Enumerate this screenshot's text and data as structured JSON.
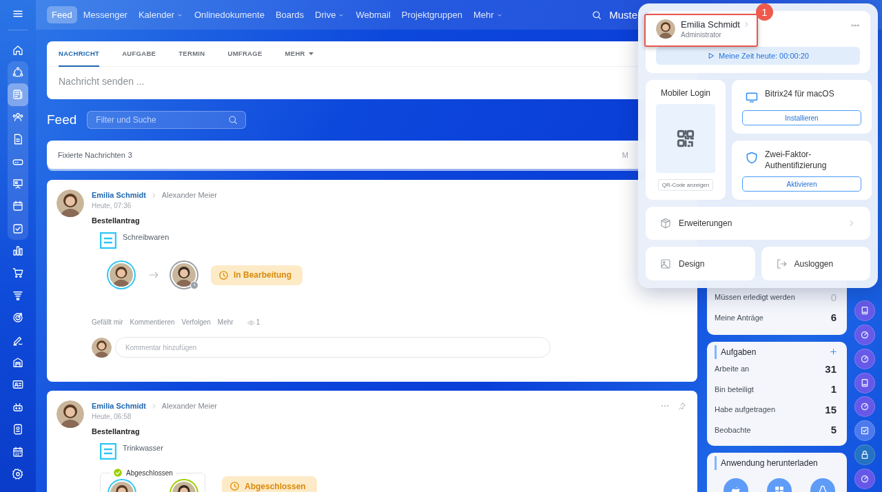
{
  "sidebar": {
    "items": [
      {
        "selected": false
      },
      {
        "selected": false
      },
      {
        "selected": false
      },
      {
        "selected": true
      },
      {
        "selected": false
      },
      {
        "selected": false
      },
      {
        "selected": false
      },
      {
        "selected": false
      },
      {
        "selected": false
      },
      {
        "selected": false
      },
      {
        "selected": false
      },
      {
        "selected": false
      },
      {
        "selected": false
      },
      {
        "selected": false
      },
      {
        "selected": false
      },
      {
        "selected": false
      },
      {
        "selected": false
      },
      {
        "selected": false
      },
      {
        "selected": false
      },
      {
        "selected": false
      },
      {
        "selected": false
      }
    ]
  },
  "topbar": {
    "nav": [
      {
        "label": "Feed",
        "selected": true,
        "dropdown": false
      },
      {
        "label": "Messenger",
        "selected": false,
        "dropdown": false
      },
      {
        "label": "Kalender",
        "selected": false,
        "dropdown": true
      },
      {
        "label": "Onlinedokumente",
        "selected": false,
        "dropdown": false
      },
      {
        "label": "Boards",
        "selected": false,
        "dropdown": false
      },
      {
        "label": "Drive",
        "selected": false,
        "dropdown": true
      },
      {
        "label": "Webmail",
        "selected": false,
        "dropdown": false
      },
      {
        "label": "Projektgruppen",
        "selected": false,
        "dropdown": false
      },
      {
        "label": "Mehr",
        "selected": false,
        "dropdown": true
      }
    ],
    "user_name": "Muste"
  },
  "composer": {
    "tabs": [
      {
        "label": "NACHRICHT",
        "selected": true,
        "dropdown": false
      },
      {
        "label": "AUFGABE",
        "selected": false,
        "dropdown": false
      },
      {
        "label": "TERMIN",
        "selected": false,
        "dropdown": false
      },
      {
        "label": "UMFRAGE",
        "selected": false,
        "dropdown": false
      },
      {
        "label": "MEHR",
        "selected": false,
        "dropdown": true
      }
    ],
    "placeholder": "Nachricht senden ..."
  },
  "feed": {
    "title": "Feed",
    "filter_placeholder": "Filter und Suche",
    "pinned": {
      "label": "Fixierte Nachrichten",
      "count": "3",
      "more": "M"
    },
    "posts": [
      {
        "author": "Emilia Schmidt",
        "recipient": "Alexander Meier",
        "time": "Heute, 07:36",
        "title": "Bestellantrag",
        "document": "Schreibwaren",
        "flow": {
          "kind": "in_progress",
          "status": "In Bearbeitung"
        },
        "actions": [
          "Gefällt mir",
          "Kommentieren",
          "Verfolgen",
          "Mehr"
        ],
        "views": "1",
        "comment_placeholder": "Kommentar hinzufügen"
      },
      {
        "author": "Emilia Schmidt",
        "recipient": "Alexander Meier",
        "time": "Heute, 06:58",
        "title": "Bestellantrag",
        "document": "Trinkwasser",
        "flow": {
          "kind": "completed",
          "label": "Abgeschlossen",
          "status": "Abgeschlossen"
        },
        "toolbar": true
      }
    ]
  },
  "widgets": [
    {
      "rows": [
        {
          "label": "Müssen erledigt werden",
          "count": "0",
          "muted": true
        },
        {
          "label": "Meine Anträge",
          "count": "6",
          "muted": false
        }
      ]
    },
    {
      "title": "Aufgaben",
      "add": true,
      "rows": [
        {
          "label": "Arbeite an",
          "count": "31",
          "muted": false
        },
        {
          "label": "Bin beteiligt",
          "count": "1",
          "muted": false
        },
        {
          "label": "Habe aufgetragen",
          "count": "15",
          "muted": false
        },
        {
          "label": "Beobachte",
          "count": "5",
          "muted": false
        }
      ]
    },
    {
      "title": "Anwendung herunterladen",
      "downloads": [
        {
          "kind": "apple"
        },
        {
          "kind": "windows"
        },
        {
          "kind": "linux"
        }
      ]
    }
  ],
  "apps": [
    {
      "kind": "book"
    },
    {
      "kind": "gauge"
    },
    {
      "kind": "gauge"
    },
    {
      "kind": "book"
    },
    {
      "kind": "gauge"
    },
    {
      "kind": "check"
    },
    {
      "kind": "lock"
    },
    {
      "kind": "gauge"
    }
  ],
  "profile_menu": {
    "user": {
      "name": "Emilia Schmidt",
      "role": "Administrator"
    },
    "timer": "Meine Zeit heute: 00:00:20",
    "mobile_login": {
      "title": "Mobiler Login",
      "button": "QR-Code anzeigen"
    },
    "apps": [
      {
        "kind": "desktop",
        "title": "Bitrix24 für macOS",
        "button": "Installieren"
      },
      {
        "kind": "security",
        "title": "Zwei-Faktor-Authentifizierung",
        "button": "Aktivieren"
      }
    ],
    "links": [
      {
        "kind": "extensions",
        "label": "Erweiterungen"
      }
    ],
    "footer": [
      {
        "kind": "design",
        "label": "Design"
      },
      {
        "kind": "logout",
        "label": "Ausloggen"
      }
    ],
    "callout": {
      "number": "1"
    }
  }
}
